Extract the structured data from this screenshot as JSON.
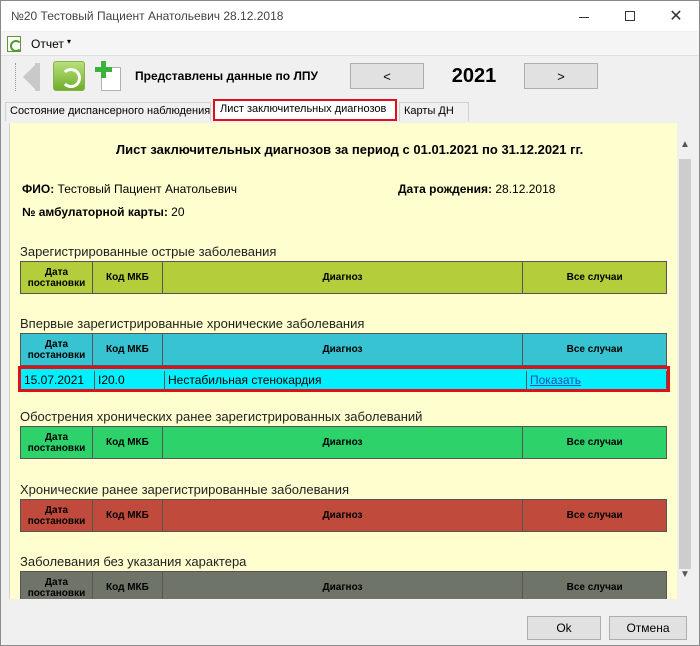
{
  "window": {
    "title": "№20 Тестовый Пациент Анатольевич 28.12.2018",
    "minimize_icon": "minimize-icon",
    "maximize_icon": "maximize-icon",
    "close_glyph": "✕"
  },
  "menu": {
    "icon": "report-icon",
    "report_label": "Отчет",
    "caret": "▾"
  },
  "toolbar": {
    "back_icon": "back-arrow-icon",
    "refresh_icon": "refresh-icon",
    "add_icon": "add-document-icon",
    "label": "Представлены данные по ЛПУ",
    "prev_label": "<",
    "year": "2021",
    "next_label": ">"
  },
  "tabs": [
    {
      "label": "Состояние диспансерного наблюдения",
      "active": false
    },
    {
      "label": "Лист заключительных диагнозов",
      "active": true
    },
    {
      "label": "Карты ДН",
      "active": false
    }
  ],
  "report": {
    "title": "Лист заключительных диагнозов за период с 01.01.2021 по 31.12.2021 гг.",
    "fio_label": "ФИО:",
    "fio_value": "Тестовый Пациент Анатольевич",
    "birth_label": "Дата рождения:",
    "birth_value": "28.12.2018",
    "card_label": "№ амбулаторной карты:",
    "card_value": "20"
  },
  "columns": {
    "date": "Дата постановки",
    "code": "Код МКБ",
    "diagnosis": "Диагноз",
    "cases": "Все случаи"
  },
  "sections": [
    {
      "title": "Зарегистрированные острые заболевания",
      "color": "#b4cd3a"
    },
    {
      "title": "Впервые зарегистрированные хронические заболевания",
      "color": "#38c3d2"
    },
    {
      "title": "Обострения хронических ранее зарегистрированных заболеваний",
      "color": "#2ed26a"
    },
    {
      "title": "Хронические ранее зарегистрированные заболевания",
      "color": "#c04a3c"
    },
    {
      "title": "Заболевания без указания характера",
      "color": "#6e7467"
    }
  ],
  "chronic_new_rows": [
    {
      "date": "15.07.2021",
      "code": "I20.0",
      "diagnosis": "Нестабильная стенокардия",
      "link": "Показать"
    }
  ],
  "highlight_color": "#e0101a",
  "scrollbar": {
    "up": "▲",
    "down": "▼"
  },
  "footer": {
    "ok_label": "Ok",
    "cancel_label": "Отмена"
  }
}
